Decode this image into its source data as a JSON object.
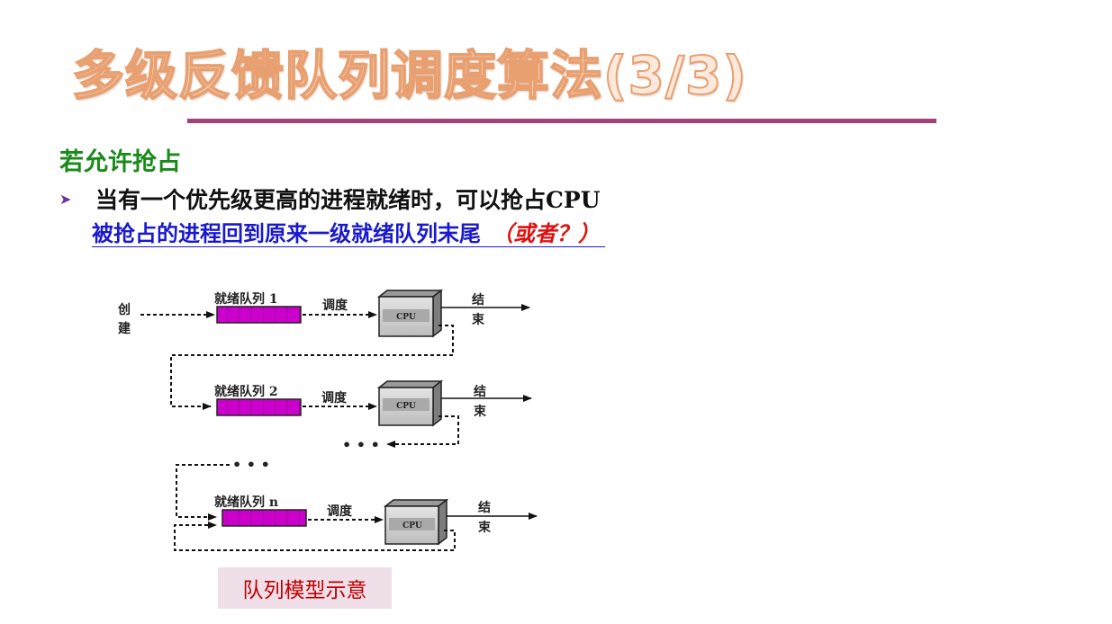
{
  "slide": {
    "title": "多级反馈队列调度算法(3/3)",
    "heading": "若允许抢占",
    "bullet": {
      "marker_icon": "arrow-bullet-icon",
      "text": "当有一个优先级更高的进程就绪时，可以抢占CPU"
    },
    "subline": {
      "text": "被抢占的进程回到原来一级就绪队列末尾",
      "note": "（或者？）"
    },
    "caption": "队列模型示意",
    "colors": {
      "title_fill": "#fde9dc",
      "title_outline": "#e8a070",
      "rule": "#a0417b",
      "heading": "#1a8a1a",
      "subline": "#1a1acc",
      "note": "#e01010",
      "queue_fill": "#cc00cc",
      "caption_bg": "#efdfe9",
      "caption_text": "#c00000"
    }
  },
  "diagram": {
    "create_label": [
      "创",
      "建"
    ],
    "queue_labels": [
      "就绪队列 1",
      "就绪队列 2",
      "就绪队列 n"
    ],
    "dispatch_label": "调度",
    "cpu_label": "CPU",
    "end_label": [
      "结",
      "束"
    ],
    "ellipsis": "• • •"
  }
}
